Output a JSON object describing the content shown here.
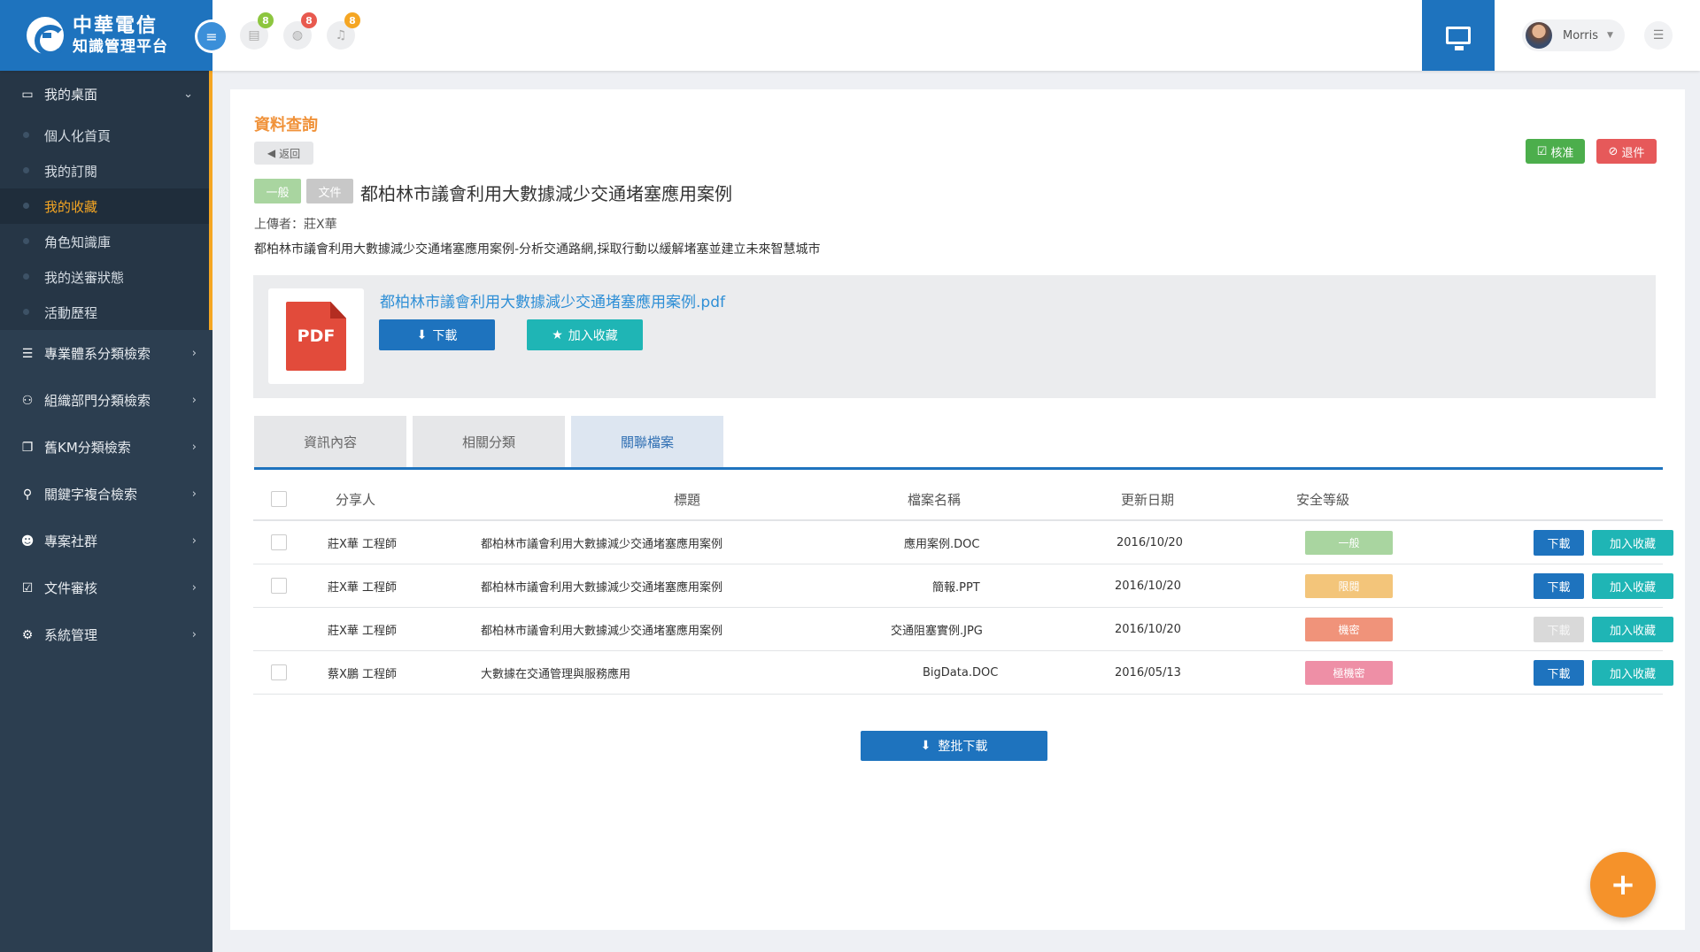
{
  "brand": {
    "line1": "中華電信",
    "line2": "知識管理平台"
  },
  "topbar": {
    "badges": [
      "8",
      "8",
      "8"
    ],
    "user_name": "Morris"
  },
  "sidebar": {
    "desktop": {
      "label": "我的桌面",
      "items": [
        "個人化首頁",
        "我的訂閱",
        "我的收藏",
        "角色知識庫",
        "我的送審狀態",
        "活動歷程"
      ]
    },
    "sections": [
      "專業體系分類檢索",
      "組織部門分類檢索",
      "舊KM分類檢索",
      "關鍵字複合檢索",
      "專案社群",
      "文件審核",
      "系統管理"
    ]
  },
  "main": {
    "section_title": "資料查詢",
    "back_label": "返回",
    "approve_label": "核准",
    "reject_label": "退件",
    "tag_general": "一般",
    "tag_doc": "文件",
    "doc_title": "都柏林市議會利用大數據減少交通堵塞應用案例",
    "uploader": "上傳者：莊X華",
    "description": "都柏林市議會利用大數據減少交通堵塞應用案例-分析交通路網,採取行動以緩解堵塞並建立未來智慧城市",
    "file": {
      "icon_text": "PDF",
      "name": "都柏林市議會利用大數據減少交通堵塞應用案例.pdf",
      "download_label": "下載",
      "favorite_label": "加入收藏"
    },
    "tabs": [
      "資訊內容",
      "相關分類",
      "關聯檔案"
    ],
    "table": {
      "headers": [
        "分享人",
        "標題",
        "檔案名稱",
        "更新日期",
        "安全等級"
      ],
      "rows": [
        {
          "sharer": "莊X華 工程師",
          "title": "都柏林市議會利用大數據減少交通堵塞應用案例",
          "file": "應用案例.DOC",
          "date": "2016/10/20",
          "level": "一般",
          "level_color": "#a9d5a0",
          "download": "下載",
          "favorite": "加入收藏",
          "has_checkbox": true,
          "download_enabled": true
        },
        {
          "sharer": "莊X華 工程師",
          "title": "都柏林市議會利用大數據減少交通堵塞應用案例",
          "file": "簡報.PPT",
          "date": "2016/10/20",
          "level": "限閱",
          "level_color": "#f3c57a",
          "download": "下載",
          "favorite": "加入收藏",
          "has_checkbox": true,
          "download_enabled": true
        },
        {
          "sharer": "莊X華 工程師",
          "title": "都柏林市議會利用大數據減少交通堵塞應用案例",
          "file": "交通阻塞實例.JPG",
          "date": "2016/10/20",
          "level": "機密",
          "level_color": "#f0937a",
          "download": "下載",
          "favorite": "加入收藏",
          "has_checkbox": false,
          "download_enabled": false
        },
        {
          "sharer": "蔡X鵬 工程師",
          "title": "大數據在交通管理與服務應用",
          "file": "BigData.DOC",
          "date": "2016/05/13",
          "level": "極機密",
          "level_color": "#ee8fa6",
          "download": "下載",
          "favorite": "加入收藏",
          "has_checkbox": true,
          "download_enabled": true
        }
      ]
    },
    "batch_download": "整批下載"
  },
  "fab_symbol": "+"
}
